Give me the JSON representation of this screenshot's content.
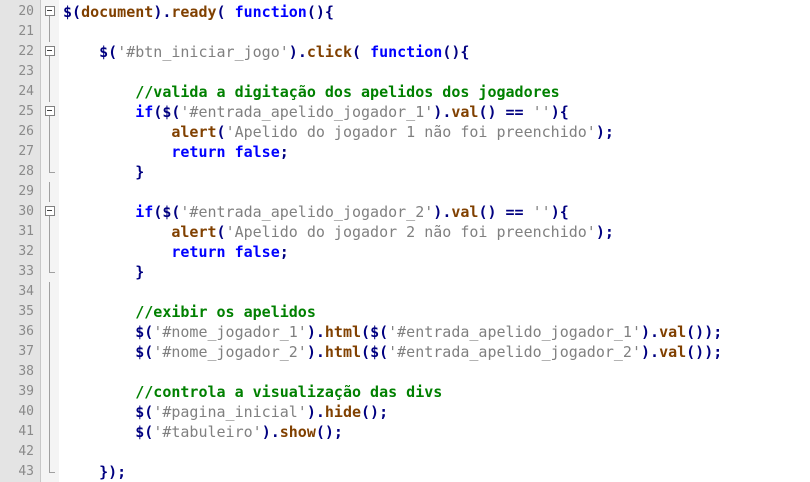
{
  "editor": {
    "lines": [
      {
        "n": "20",
        "fold": "box",
        "code": [
          [
            "$",
            "bold"
          ],
          [
            "(",
            "op"
          ],
          [
            "document",
            "fn"
          ],
          [
            ")",
            "op"
          ],
          [
            ".",
            "op"
          ],
          [
            "ready",
            "fn"
          ],
          [
            "( ",
            "op"
          ],
          [
            "function",
            "kw"
          ],
          [
            "(){",
            "op"
          ]
        ]
      },
      {
        "n": "21",
        "fold": "vline",
        "code": []
      },
      {
        "n": "22",
        "fold": "box",
        "code": [
          [
            "    ",
            ""
          ],
          [
            "$",
            "bold"
          ],
          [
            "(",
            "op"
          ],
          [
            "'#btn_iniciar_jogo'",
            "str"
          ],
          [
            ")",
            "op"
          ],
          [
            ".",
            "op"
          ],
          [
            "click",
            "fn"
          ],
          [
            "( ",
            "op"
          ],
          [
            "function",
            "kw"
          ],
          [
            "(){",
            "op"
          ]
        ]
      },
      {
        "n": "23",
        "fold": "vline",
        "code": []
      },
      {
        "n": "24",
        "fold": "vline",
        "code": [
          [
            "        ",
            ""
          ],
          [
            "//valida a digitação dos apelidos dos jogadores",
            "cm"
          ]
        ]
      },
      {
        "n": "25",
        "fold": "box",
        "code": [
          [
            "        ",
            ""
          ],
          [
            "if",
            "kw"
          ],
          [
            "(",
            "op"
          ],
          [
            "$",
            "bold"
          ],
          [
            "(",
            "op"
          ],
          [
            "'#entrada_apelido_jogador_1'",
            "str"
          ],
          [
            ")",
            "op"
          ],
          [
            ".",
            "op"
          ],
          [
            "val",
            "fn"
          ],
          [
            "() == ",
            "op"
          ],
          [
            "''",
            "str"
          ],
          [
            "){",
            "op"
          ]
        ]
      },
      {
        "n": "26",
        "fold": "vline",
        "code": [
          [
            "            ",
            ""
          ],
          [
            "alert",
            "fn"
          ],
          [
            "(",
            "op"
          ],
          [
            "'Apelido do jogador 1 não foi preenchido'",
            "str"
          ],
          [
            ");",
            "op"
          ]
        ]
      },
      {
        "n": "27",
        "fold": "vline",
        "code": [
          [
            "            ",
            ""
          ],
          [
            "return",
            "kw"
          ],
          [
            " ",
            ""
          ],
          [
            "false",
            "kw"
          ],
          [
            ";",
            "op"
          ]
        ]
      },
      {
        "n": "28",
        "fold": "end",
        "code": [
          [
            "        ",
            ""
          ],
          [
            "}",
            "op"
          ]
        ]
      },
      {
        "n": "29",
        "fold": "vline",
        "code": []
      },
      {
        "n": "30",
        "fold": "box",
        "code": [
          [
            "        ",
            ""
          ],
          [
            "if",
            "kw"
          ],
          [
            "(",
            "op"
          ],
          [
            "$",
            "bold"
          ],
          [
            "(",
            "op"
          ],
          [
            "'#entrada_apelido_jogador_2'",
            "str"
          ],
          [
            ")",
            "op"
          ],
          [
            ".",
            "op"
          ],
          [
            "val",
            "fn"
          ],
          [
            "() == ",
            "op"
          ],
          [
            "''",
            "str"
          ],
          [
            "){",
            "op"
          ]
        ]
      },
      {
        "n": "31",
        "fold": "vline",
        "code": [
          [
            "            ",
            ""
          ],
          [
            "alert",
            "fn"
          ],
          [
            "(",
            "op"
          ],
          [
            "'Apelido do jogador 2 não foi preenchido'",
            "str"
          ],
          [
            ");",
            "op"
          ]
        ]
      },
      {
        "n": "32",
        "fold": "vline",
        "code": [
          [
            "            ",
            ""
          ],
          [
            "return",
            "kw"
          ],
          [
            " ",
            ""
          ],
          [
            "false",
            "kw"
          ],
          [
            ";",
            "op"
          ]
        ]
      },
      {
        "n": "33",
        "fold": "end",
        "code": [
          [
            "        ",
            ""
          ],
          [
            "}",
            "op"
          ]
        ]
      },
      {
        "n": "34",
        "fold": "vline",
        "code": []
      },
      {
        "n": "35",
        "fold": "vline",
        "code": [
          [
            "        ",
            ""
          ],
          [
            "//exibir os apelidos",
            "cm"
          ]
        ]
      },
      {
        "n": "36",
        "fold": "vline",
        "code": [
          [
            "        ",
            ""
          ],
          [
            "$",
            "bold"
          ],
          [
            "(",
            "op"
          ],
          [
            "'#nome_jogador_1'",
            "str"
          ],
          [
            ")",
            "op"
          ],
          [
            ".",
            "op"
          ],
          [
            "html",
            "fn"
          ],
          [
            "(",
            "op"
          ],
          [
            "$",
            "bold"
          ],
          [
            "(",
            "op"
          ],
          [
            "'#entrada_apelido_jogador_1'",
            "str"
          ],
          [
            ")",
            "op"
          ],
          [
            ".",
            "op"
          ],
          [
            "val",
            "fn"
          ],
          [
            "());",
            "op"
          ]
        ]
      },
      {
        "n": "37",
        "fold": "vline",
        "code": [
          [
            "        ",
            ""
          ],
          [
            "$",
            "bold"
          ],
          [
            "(",
            "op"
          ],
          [
            "'#nome_jogador_2'",
            "str"
          ],
          [
            ")",
            "op"
          ],
          [
            ".",
            "op"
          ],
          [
            "html",
            "fn"
          ],
          [
            "(",
            "op"
          ],
          [
            "$",
            "bold"
          ],
          [
            "(",
            "op"
          ],
          [
            "'#entrada_apelido_jogador_2'",
            "str"
          ],
          [
            ")",
            "op"
          ],
          [
            ".",
            "op"
          ],
          [
            "val",
            "fn"
          ],
          [
            "());",
            "op"
          ]
        ]
      },
      {
        "n": "38",
        "fold": "vline",
        "code": []
      },
      {
        "n": "39",
        "fold": "vline",
        "code": [
          [
            "        ",
            ""
          ],
          [
            "//controla a visualização das divs",
            "cm"
          ]
        ]
      },
      {
        "n": "40",
        "fold": "vline",
        "code": [
          [
            "        ",
            ""
          ],
          [
            "$",
            "bold"
          ],
          [
            "(",
            "op"
          ],
          [
            "'#pagina_inicial'",
            "str"
          ],
          [
            ")",
            "op"
          ],
          [
            ".",
            "op"
          ],
          [
            "hide",
            "fn"
          ],
          [
            "();",
            "op"
          ]
        ]
      },
      {
        "n": "41",
        "fold": "vline",
        "code": [
          [
            "        ",
            ""
          ],
          [
            "$",
            "bold"
          ],
          [
            "(",
            "op"
          ],
          [
            "'#tabuleiro'",
            "str"
          ],
          [
            ")",
            "op"
          ],
          [
            ".",
            "op"
          ],
          [
            "show",
            "fn"
          ],
          [
            "();",
            "op"
          ]
        ]
      },
      {
        "n": "42",
        "fold": "vline",
        "code": []
      },
      {
        "n": "43",
        "fold": "end",
        "code": [
          [
            "    ",
            ""
          ],
          [
            "});",
            "op"
          ]
        ]
      }
    ],
    "colors": {
      "keyword": "#0000ff",
      "string": "#808080",
      "comment": "#008000",
      "function": "#804000",
      "operator": "#000080",
      "gutter": "#e4e4e4"
    }
  }
}
